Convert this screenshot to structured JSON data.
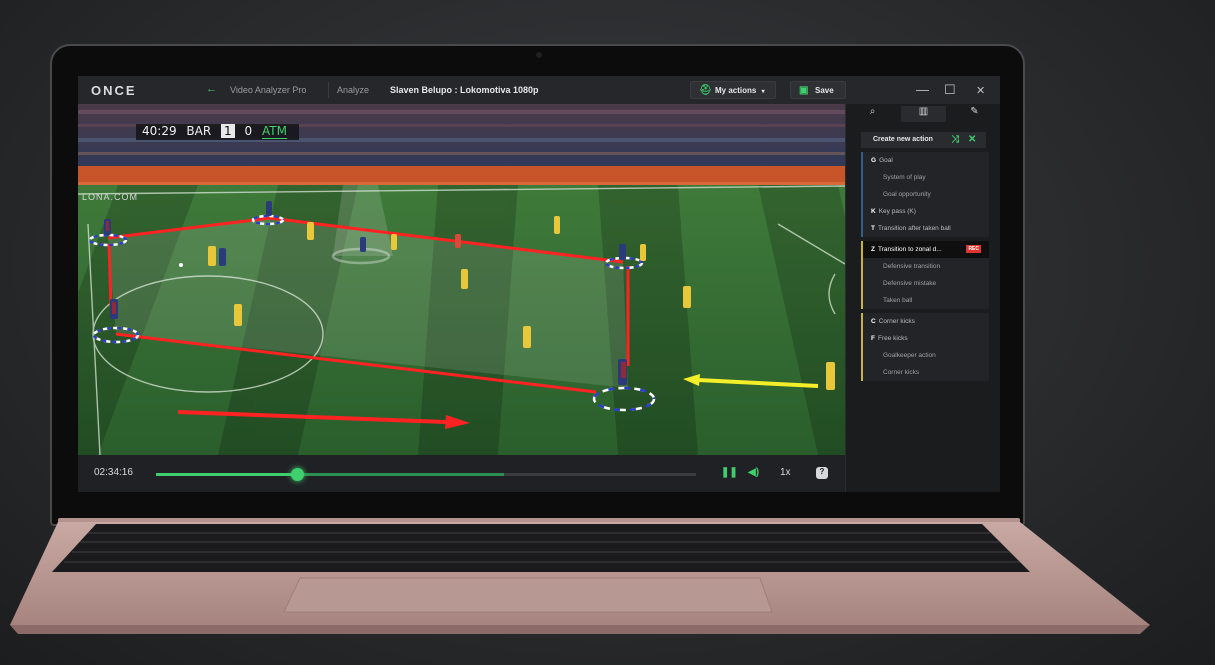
{
  "app": {
    "logo": "ONCE",
    "back_icon": "arrow-left-icon",
    "breadcrumb_1": "Video Analyzer Pro",
    "breadcrumb_2": "Analyze",
    "video_title": "Slaven Belupo : Lokomotiva 1080p",
    "my_actions_label": "My actions",
    "save_label": "Save",
    "accent_color": "#3ecf6e"
  },
  "window_controls": {
    "minimize": "—",
    "maximize": "☐",
    "close": "✕"
  },
  "scoreboard": {
    "clock": "40:29",
    "home": "BAR",
    "home_score": "1",
    "away_score": "0",
    "away": "ATM"
  },
  "pitch_text": "LONA.COM",
  "player": {
    "current_time": "02:34:16",
    "progress": 0.26,
    "pause_icon": "pause-icon",
    "volume_icon": "volume-icon",
    "speed": "1x",
    "help_icon": "help-icon"
  },
  "panel": {
    "tabs": [
      "search-zoom-icon",
      "trash-icon",
      "pen-icon"
    ],
    "create_label": "Create new action",
    "actions": [
      {
        "key": "G",
        "label": "Goal"
      },
      {
        "key": "",
        "label": "System of play"
      },
      {
        "key": "",
        "label": "Goal opportunity"
      },
      {
        "key": "K",
        "label": "Key pass (K)"
      },
      {
        "key": "T",
        "label": "Transition after taken ball"
      },
      {
        "key": "Z",
        "label": "Transition to zonal d...",
        "badge": "REC"
      },
      {
        "key": "",
        "label": "Defensive transition"
      },
      {
        "key": "",
        "label": "Defensive mistake"
      },
      {
        "key": "",
        "label": "Taken ball"
      },
      {
        "key": "C",
        "label": "Corner kicks"
      },
      {
        "key": "F",
        "label": "Free kicks"
      },
      {
        "key": "",
        "label": "Goalkeeper action"
      },
      {
        "key": "",
        "label": "Corner kicks"
      }
    ]
  }
}
